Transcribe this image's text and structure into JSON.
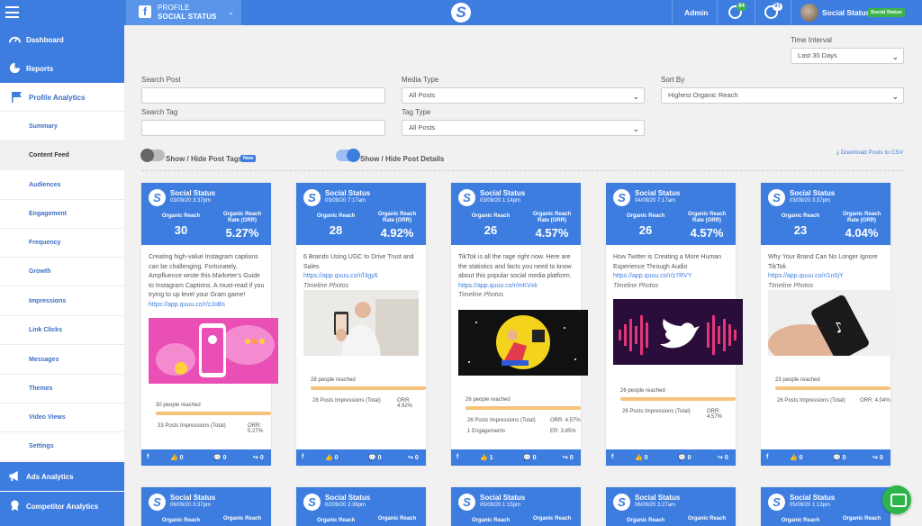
{
  "header": {
    "profile_label": "PROFILE",
    "profile_name": "SOCIAL STATUS",
    "admin_label": "Admin",
    "badge_one": "94",
    "badge_two": "91",
    "user_name": "Social Status",
    "user_chip": "Social Status"
  },
  "sidebar": {
    "dashboard": "Dashboard",
    "reports": "Reports",
    "profile_analytics": "Profile Analytics",
    "sub_items": [
      "Summary",
      "Content Feed",
      "Audiences",
      "Engagement",
      "Frequency",
      "Growth",
      "Impressions",
      "Link Clicks",
      "Messages",
      "Themes",
      "Video Views",
      "Settings"
    ],
    "ads_analytics": "Ads Analytics",
    "competitor_analytics": "Competitor Analytics"
  },
  "filters": {
    "time_interval_label": "Time Interval",
    "time_interval_value": "Last 30 Days",
    "search_post_label": "Search Post",
    "media_type_label": "Media Type",
    "media_type_value": "All Posts",
    "sort_by_label": "Sort By",
    "sort_by_value": "Highest Organic Reach",
    "search_tag_label": "Search Tag",
    "tag_type_label": "Tag Type",
    "tag_type_value": "All Posts",
    "toggle_tags_label": "Show / Hide Post Tags",
    "new_badge": "New",
    "toggle_details_label": "Show / Hide Post Details",
    "download_label": "Download Posts to CSV"
  },
  "card_labels": {
    "reach": "Organic Reach",
    "orr_line1": "Organic Reach",
    "orr_line2": "Rate (ORR)"
  },
  "cards": [
    {
      "name": "Social Status",
      "date": "03/09/20 3:37pm",
      "reach": "30",
      "orr": "5.27%",
      "text": "Creating high-value Instagram captions can be challenging. Fortunately, Ampfluence wrote this Marketer's Guide to Instagram Captions. A must-read if you trying to up level your Gram game!",
      "link": "https://app.quuu.co/r/zJoBs",
      "media": "",
      "people": "30 people reached",
      "impressions": "33 Posts Impressions (Total)",
      "orr_small": "ORR: 5.27%",
      "engagements": "",
      "er": "",
      "likes": "0",
      "comments": "0",
      "shares": "0"
    },
    {
      "name": "Social Status",
      "date": "03/09/20 7:17am",
      "reach": "28",
      "orr": "4.92%",
      "text": "6 Brands Using UGC to Drive Trust and Sales",
      "link": "https://app.quuu.co/r/l3gy6",
      "media": "Timeline Photos",
      "people": "28 people reached",
      "impressions": "28 Posts Impressions (Total)",
      "orr_small": "ORR: 4.92%",
      "engagements": "",
      "er": "",
      "likes": "0",
      "comments": "0",
      "shares": "0"
    },
    {
      "name": "Social Status",
      "date": "03/09/20 1:14pm",
      "reach": "26",
      "orr": "4.57%",
      "text": "TikTok is all the rage right now. Here are the statistics and facts you need to know about this popular social media platform.",
      "link": "https://app.quuu.co/r/mKVxk",
      "media": "Timeline Photos",
      "people": "26 people reached",
      "impressions": "26 Posts Impressions (Total)",
      "orr_small": "ORR: 4.57%",
      "engagements": "1 Engagements",
      "er": "ER: 3.85%",
      "likes": "1",
      "comments": "0",
      "shares": "0"
    },
    {
      "name": "Social Status",
      "date": "04/09/20 7:17am",
      "reach": "26",
      "orr": "4.57%",
      "text": "How Twitter is Creating a More Human Experience Through Audio",
      "link": "https://app.quuu.co/r/z7RVY",
      "media": "Timeline Photos",
      "people": "26 people reached",
      "impressions": "26 Posts Impressions (Total)",
      "orr_small": "ORR: 4.57%",
      "engagements": "",
      "er": "",
      "likes": "0",
      "comments": "0",
      "shares": "0"
    },
    {
      "name": "Social Status",
      "date": "03/09/20 3:37pm",
      "reach": "23",
      "orr": "4.04%",
      "text": "Why Your Brand Can No Longer Ignore TikTok",
      "link": "https://app.quuu.co/r/1n0jY",
      "media": "Timeline Photos",
      "people": "23 people reached",
      "impressions": "26 Posts Impressions (Total)",
      "orr_small": "ORR: 4.04%",
      "engagements": "",
      "er": "",
      "likes": "0",
      "comments": "0",
      "shares": "0"
    }
  ],
  "cards_row2": [
    {
      "name": "Social Status",
      "date": "06/09/20 3:37pm"
    },
    {
      "name": "Social Status",
      "date": "02/09/20 2:36pm"
    },
    {
      "name": "Social Status",
      "date": "05/09/20 1:15pm"
    },
    {
      "name": "Social Status",
      "date": "06/09/20 3:27am"
    },
    {
      "name": "Social Status",
      "date": "05/09/20 1:13pm"
    }
  ],
  "colors": {
    "primary": "#3d7de0",
    "reach_bar": "#f7c27c",
    "badge_green": "#3cb44a"
  }
}
